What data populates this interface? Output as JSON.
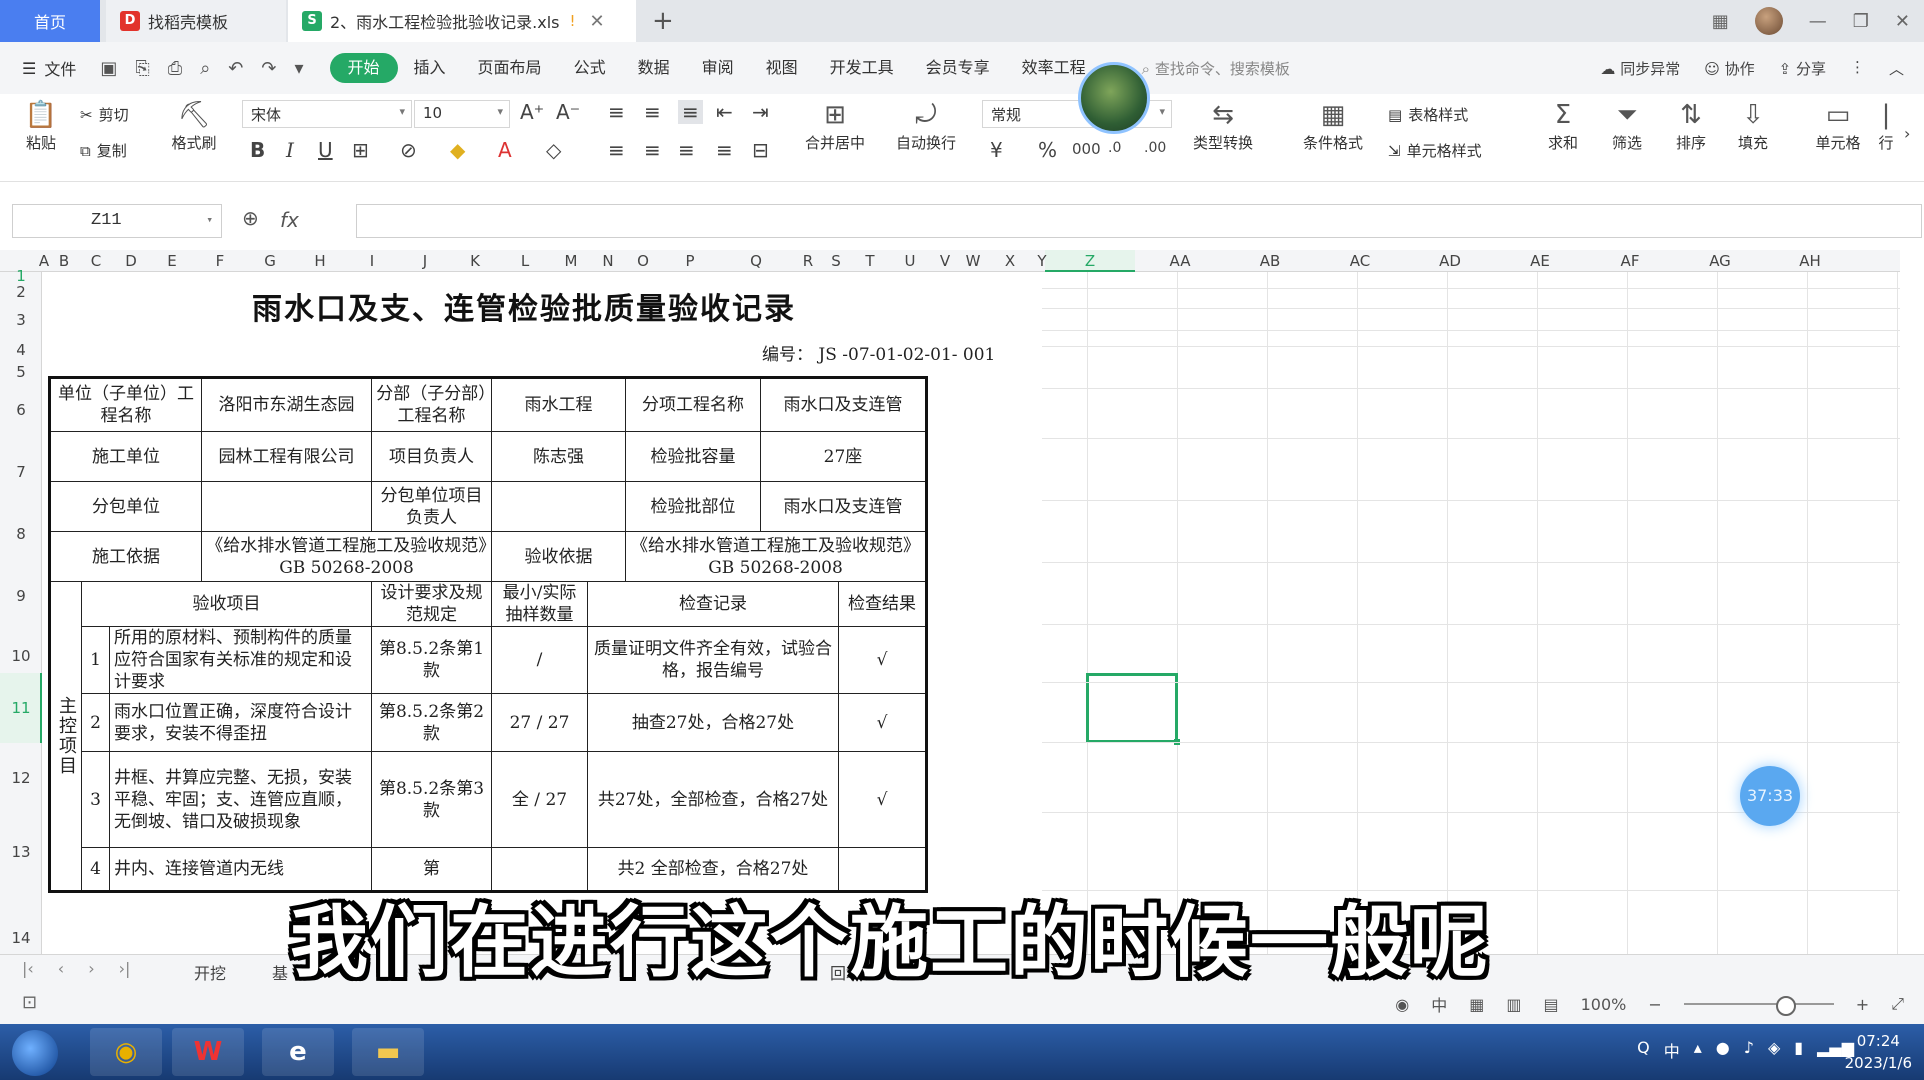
{
  "titlebar": {
    "home_tab": "首页",
    "template_tab": "找稻壳模板",
    "file_tab": "2、雨水工程检验批验收记录.xls",
    "file_tab_icon": "S",
    "warning_icon": "!",
    "close_icon": "✕",
    "new_tab": "+"
  },
  "menubar": {
    "file": "文件",
    "items": [
      "开始",
      "插入",
      "页面布局",
      "公式",
      "数据",
      "审阅",
      "视图",
      "开发工具",
      "会员专享",
      "效率工程"
    ],
    "active": "开始",
    "search": "查找命令、搜索模板",
    "sync": "同步异常",
    "collab": "协作",
    "share": "分享"
  },
  "ribbon": {
    "paste": "粘贴",
    "cut": "剪切",
    "copy": "复制",
    "format_painter": "格式刷",
    "font": "宋体",
    "font_size": "10",
    "merge_center": "合并居中",
    "wrap": "自动换行",
    "number_format": "常规",
    "type_convert": "类型转换",
    "cond_format": "条件格式",
    "table_style": "表格样式",
    "cell_style": "单元格样式",
    "sum": "求和",
    "filter": "筛选",
    "sort": "排序",
    "fill": "填充",
    "cell": "单元格",
    "row_col": "行"
  },
  "formula_bar": {
    "name_box": "Z11",
    "fx": "fx",
    "value": ""
  },
  "columns": [
    "A",
    "B",
    "C",
    "D",
    "E",
    "F",
    "G",
    "H",
    "I",
    "J",
    "K",
    "L",
    "M",
    "N",
    "O",
    "P",
    "Q",
    "R",
    "S",
    "T",
    "U",
    "V",
    "W",
    "X",
    "Y",
    "Z",
    "AA",
    "AB",
    "AC",
    "AD",
    "AE",
    "AF",
    "AG",
    "AH"
  ],
  "rows": [
    "1",
    "2",
    "3",
    "4",
    "5",
    "6",
    "7",
    "8",
    "9",
    "10",
    "11",
    "12",
    "13",
    "14"
  ],
  "document": {
    "title": "雨水口及支、连管检验批质量验收记录",
    "code": "编号： JS -07-01-02-01- 001",
    "r6": [
      "单位（子单位）工程名称",
      "洛阳市东湖生态园",
      "分部（子分部）工程名称",
      "雨水工程",
      "分项工程名称",
      "雨水口及支连管"
    ],
    "r7": [
      "施工单位",
      "园林工程有限公司",
      "项目负责人",
      "陈志强",
      "检验批容量",
      "27座"
    ],
    "r8": [
      "分包单位",
      "",
      "分包单位项目负责人",
      "",
      "检验批部位",
      "雨水口及支连管"
    ],
    "r9": [
      "施工依据",
      "《给水排水管道工程施工及验收规范》GB 50268-2008",
      "验收依据",
      "《给水排水管道工程施工及验收规范》GB 50268-2008"
    ],
    "r10": [
      "验收项目",
      "设计要求及规范规定",
      "最小/实际抽样数量",
      "检查记录",
      "检查结果"
    ],
    "side_label": "主控项目",
    "items": [
      {
        "no": "1",
        "desc": "所用的原材料、预制构件的质量应符合国家有关标准的规定和设计要求",
        "spec": "第8.5.2条第1款",
        "sample": "/",
        "record": "质量证明文件齐全有效，试验合格，报告编号",
        "result": "√"
      },
      {
        "no": "2",
        "desc": "雨水口位置正确，深度符合设计要求，安装不得歪扭",
        "spec": "第8.5.2条第2款",
        "sample": "27  /  27",
        "record": "抽查27处，合格27处",
        "result": "√"
      },
      {
        "no": "3",
        "desc": "井框、井算应完整、无损，安装平稳、牢固；支、连管应直顺，无倒坡、错口及破损现象",
        "spec": "第8.5.2条第3款",
        "sample": "全  /  27",
        "record": "共27处，全部检查，合格27处",
        "result": "√"
      },
      {
        "no": "4",
        "desc": "井内、连接管道内无线",
        "spec": "第",
        "sample": "",
        "record": "共2 全部检查，合格27处",
        "result": ""
      }
    ]
  },
  "sheet_tabs": [
    "开挖",
    "基",
    "插",
    "回填表"
  ],
  "status": {
    "zoom": "100%",
    "ime": "中"
  },
  "taskbar": {
    "time": "07:24",
    "date": "2023/1/6",
    "ime": "中"
  },
  "overlay": {
    "timer_badge": "37:33",
    "subtitle": "我们在进行这个施工的时候一般呢"
  }
}
